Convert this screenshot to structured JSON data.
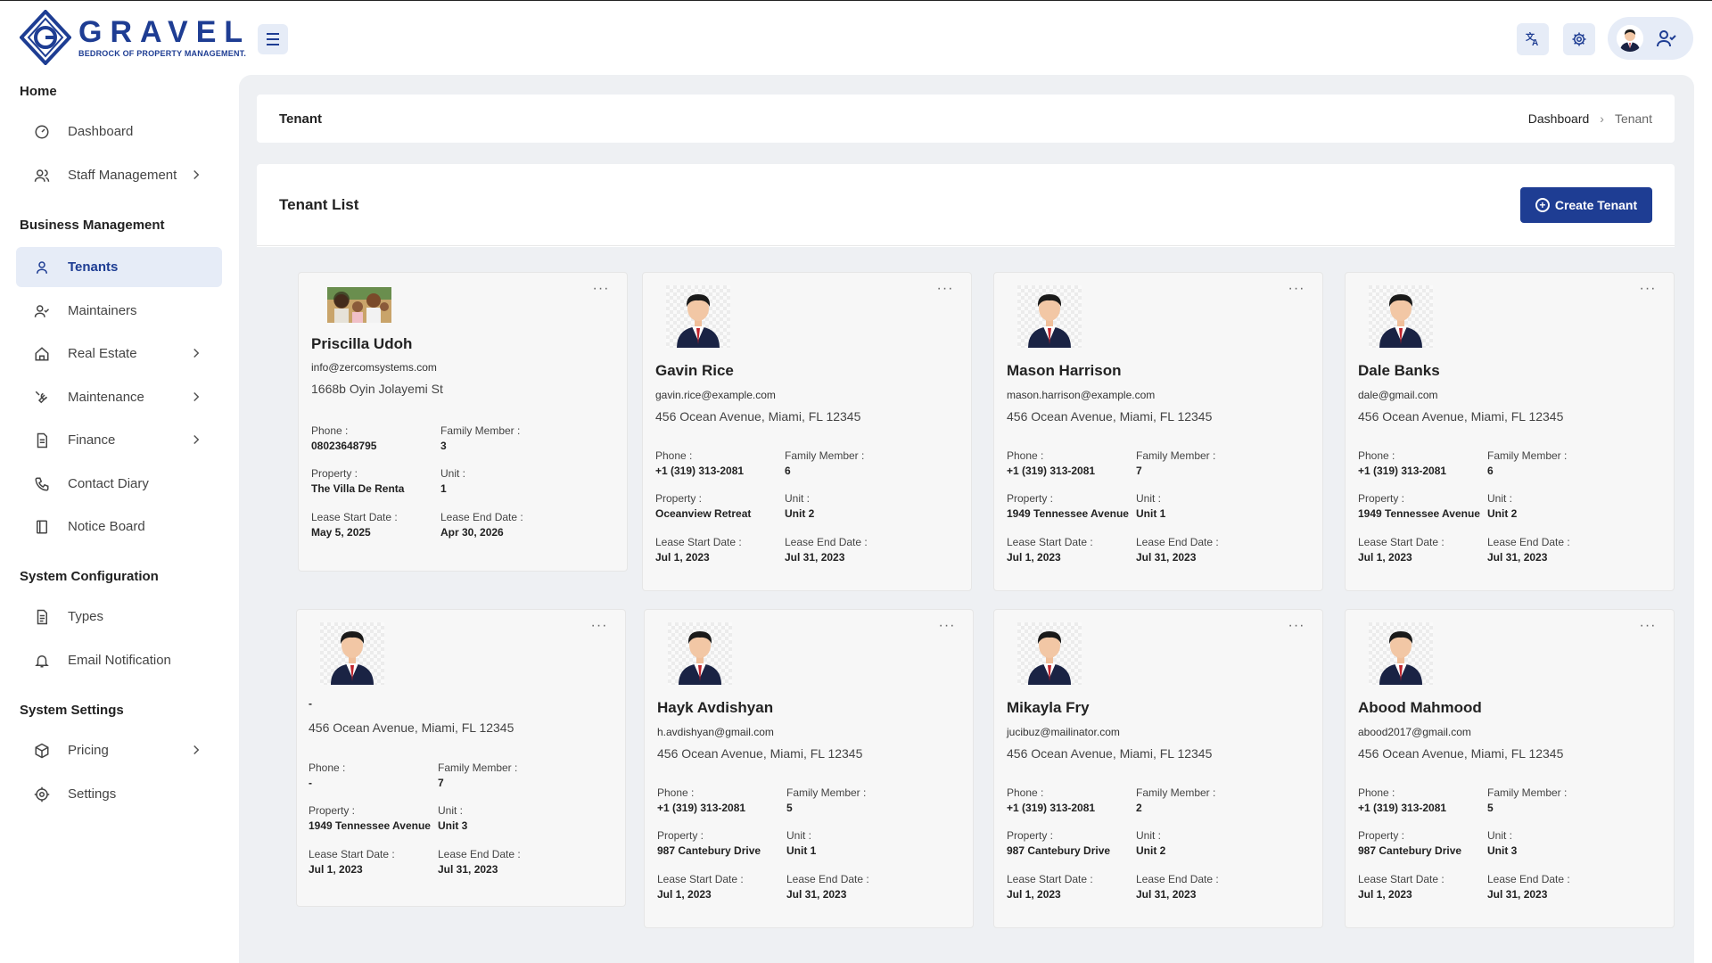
{
  "brand": {
    "name": "GRAVEL",
    "tagline": "BEDROCK OF PROPERTY MANAGEMENT."
  },
  "colors": {
    "primary": "#1e3d93",
    "active_bg": "#e6ecf7",
    "main_bg": "#eef0f3"
  },
  "topbar": {
    "menu_icon": "hamburger-icon",
    "translate_icon": "translate-icon",
    "settings_icon": "gear-icon",
    "user_icon": "user-check-icon"
  },
  "sidebar": {
    "sections": [
      {
        "title": "Home"
      },
      {
        "title": "Business Management"
      },
      {
        "title": "System Configuration"
      },
      {
        "title": "System Settings"
      }
    ],
    "items": [
      {
        "label": "Dashboard",
        "icon": "gauge-icon"
      },
      {
        "label": "Staff Management",
        "icon": "users-icon"
      },
      {
        "label": "Tenants",
        "icon": "user-icon"
      },
      {
        "label": "Maintainers",
        "icon": "user-check-icon"
      },
      {
        "label": "Real Estate",
        "icon": "home-icon"
      },
      {
        "label": "Maintenance",
        "icon": "wrench-icon"
      },
      {
        "label": "Finance",
        "icon": "document-icon"
      },
      {
        "label": "Contact Diary",
        "icon": "phone-icon"
      },
      {
        "label": "Notice Board",
        "icon": "notice-icon"
      },
      {
        "label": "Types",
        "icon": "file-icon"
      },
      {
        "label": "Email Notification",
        "icon": "bell-icon"
      },
      {
        "label": "Pricing",
        "icon": "box-icon"
      },
      {
        "label": "Settings",
        "icon": "gear-icon"
      }
    ]
  },
  "header": {
    "title": "Tenant",
    "breadcrumb": [
      "Dashboard",
      "Tenant"
    ]
  },
  "list": {
    "title": "Tenant List",
    "create_label": "Create Tenant"
  },
  "labels": {
    "phone": "Phone :",
    "family": "Family Member :",
    "property": "Property :",
    "unit": "Unit :",
    "lease_start": "Lease Start Date :",
    "lease_end": "Lease End Date :"
  },
  "tenants": [
    {
      "name": "Priscilla Udoh",
      "email": "info@zercomsystems.com",
      "address": "1668b Oyin Jolayemi St",
      "phone": "08023648795",
      "family": "3",
      "property": "The Villa De Renta",
      "unit": "1",
      "lease_start": "May 5, 2025",
      "lease_end": "Apr 30, 2026"
    },
    {
      "name": "Gavin Rice",
      "email": "gavin.rice@example.com",
      "address": "456 Ocean Avenue, Miami, FL 12345",
      "phone": "+1 (319) 313-2081",
      "family": "6",
      "property": "Oceanview Retreat",
      "unit": "Unit 2",
      "lease_start": "Jul 1, 2023",
      "lease_end": "Jul 31, 2023"
    },
    {
      "name": "Mason Harrison",
      "email": "mason.harrison@example.com",
      "address": "456 Ocean Avenue, Miami, FL 12345",
      "phone": "+1 (319) 313-2081",
      "family": "7",
      "property": "1949 Tennessee Avenue",
      "unit": "Unit 1",
      "lease_start": "Jul 1, 2023",
      "lease_end": "Jul 31, 2023"
    },
    {
      "name": "Dale Banks",
      "email": "dale@gmail.com",
      "address": "456 Ocean Avenue, Miami, FL 12345",
      "phone": "+1 (319) 313-2081",
      "family": "6",
      "property": "1949 Tennessee Avenue",
      "unit": "Unit 2",
      "lease_start": "Jul 1, 2023",
      "lease_end": "Jul 31, 2023"
    },
    {
      "name": "-",
      "email": "",
      "address": "456 Ocean Avenue, Miami, FL 12345",
      "phone": "-",
      "family": "7",
      "property": "1949 Tennessee Avenue",
      "unit": "Unit 3",
      "lease_start": "Jul 1, 2023",
      "lease_end": "Jul 31, 2023"
    },
    {
      "name": "Hayk Avdishyan",
      "email": "h.avdishyan@gmail.com",
      "address": "456 Ocean Avenue, Miami, FL 12345",
      "phone": "+1 (319) 313-2081",
      "family": "5",
      "property": "987 Cantebury Drive",
      "unit": "Unit 1",
      "lease_start": "Jul 1, 2023",
      "lease_end": "Jul 31, 2023"
    },
    {
      "name": "Mikayla Fry",
      "email": "jucibuz@mailinator.com",
      "address": "456 Ocean Avenue, Miami, FL 12345",
      "phone": "+1 (319) 313-2081",
      "family": "2",
      "property": "987 Cantebury Drive",
      "unit": "Unit 2",
      "lease_start": "Jul 1, 2023",
      "lease_end": "Jul 31, 2023"
    },
    {
      "name": "Abood Mahmood",
      "email": "abood2017@gmail.com",
      "address": "456 Ocean Avenue, Miami, FL 12345",
      "phone": "+1 (319) 313-2081",
      "family": "5",
      "property": "987 Cantebury Drive",
      "unit": "Unit 3",
      "lease_start": "Jul 1, 2023",
      "lease_end": "Jul 31, 2023"
    }
  ]
}
